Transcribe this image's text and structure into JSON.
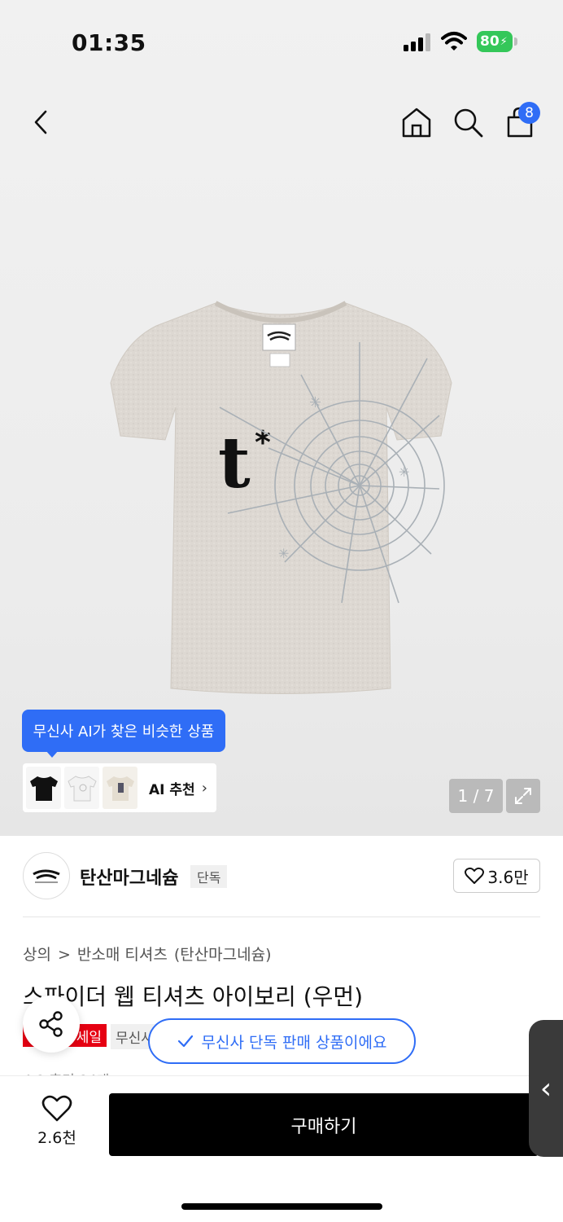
{
  "status": {
    "time": "01:35",
    "battery": "80"
  },
  "header": {
    "cart_count": "8"
  },
  "gallery": {
    "ai_bubble": "무신사 AI가 찾은 비슷한 상품",
    "ai_recommend_label": "AI 추천",
    "page_indicator": "1 / 7"
  },
  "brand": {
    "name": "탄산마그네슘",
    "tag": "단독",
    "likes": "3.6만"
  },
  "product": {
    "breadcrumb": [
      "상의",
      ">",
      "반소매 티셔츠",
      "(탄산마그네슘)"
    ],
    "title": "스파이더 웹 티셔츠 아이보리 (우먼)",
    "sale_badge": "세일",
    "musinsa_badge": "무신사",
    "exclusive_toast": "무신사 단독 판매 상품이에요",
    "partial_rating": "4.9  후기 94개"
  },
  "bottom": {
    "wish_count": "2.6천",
    "buy_label": "구매하기"
  },
  "colors": {
    "accent_blue": "#2f6df6",
    "sale_red": "#e60012",
    "battery_green": "#34c759"
  },
  "icons": [
    "back-icon",
    "home-icon",
    "search-icon",
    "cart-icon",
    "expand-icon",
    "heart-icon",
    "share-icon",
    "check-icon",
    "chevron-right-icon"
  ]
}
